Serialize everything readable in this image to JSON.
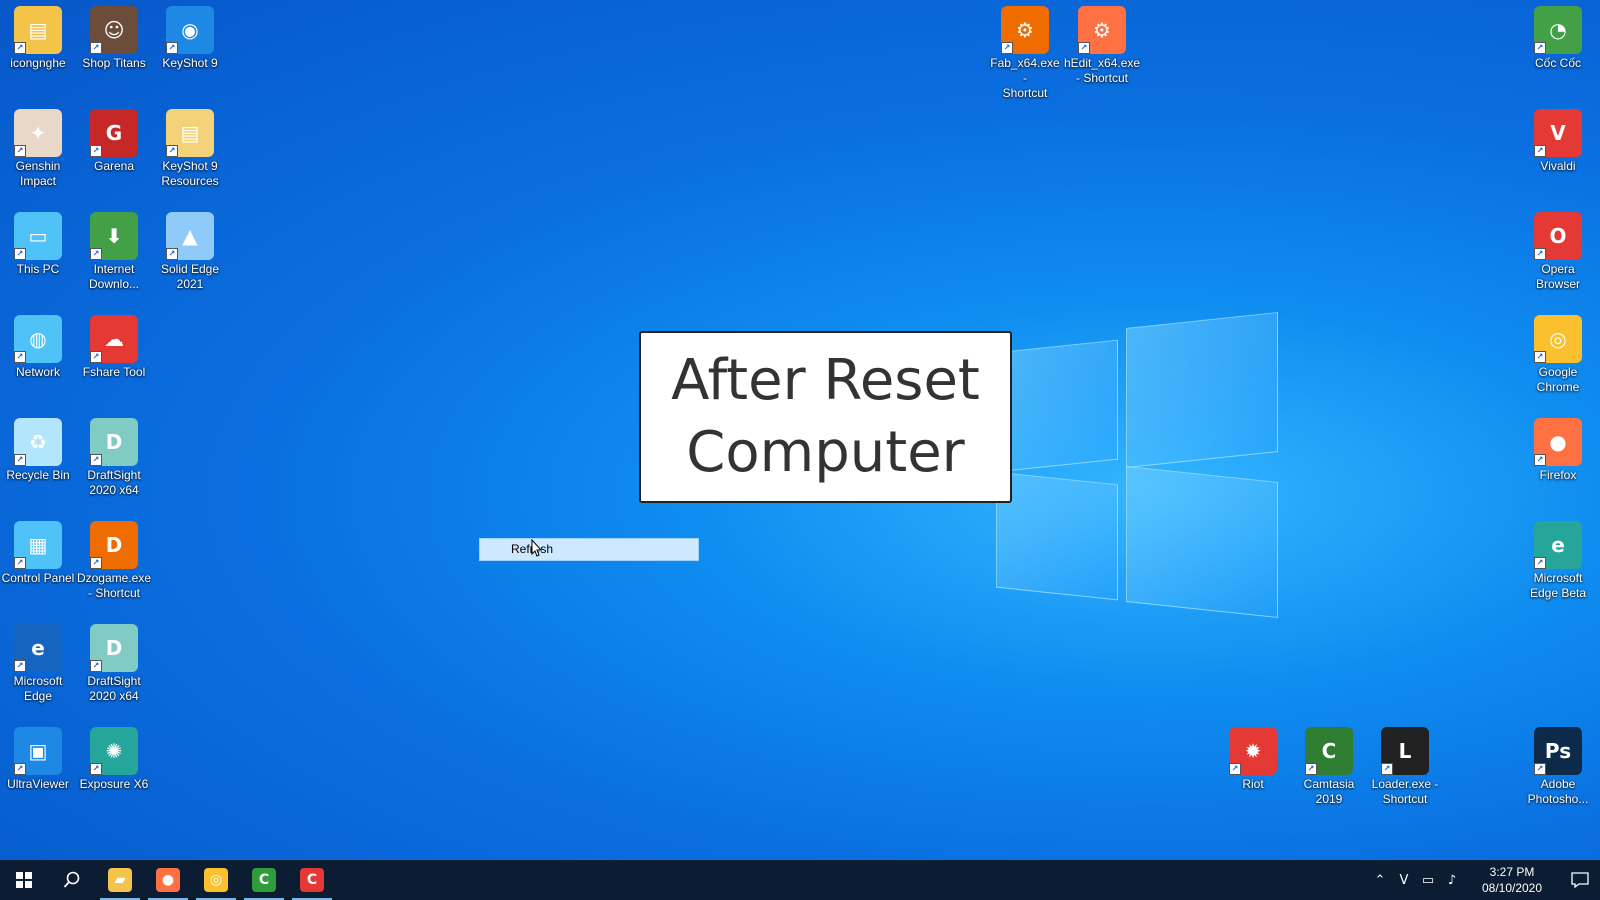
{
  "desktop": {
    "icons_left": [
      {
        "label": "icongnghe",
        "icon": "folder-icon",
        "color": "#f3c34a",
        "glyph": "▤"
      },
      {
        "label": "Shop Titans",
        "icon": "shop-titans-icon",
        "color": "#6b4d3a",
        "glyph": "☺"
      },
      {
        "label": "KeyShot 9",
        "icon": "keyshot-icon",
        "color": "#1e88e5",
        "glyph": "◉"
      },
      {
        "label": "Genshin\nImpact",
        "icon": "genshin-icon",
        "color": "#e9d7c8",
        "glyph": "✦"
      },
      {
        "label": "Garena",
        "icon": "garena-icon",
        "color": "#c62828",
        "glyph": "G"
      },
      {
        "label": "KeyShot 9\nResources",
        "icon": "folder-icon",
        "color": "#f3d27a",
        "glyph": "▤"
      },
      {
        "label": "This PC",
        "icon": "this-pc-icon",
        "color": "#4fc3f7",
        "glyph": "▭"
      },
      {
        "label": "Internet\nDownlo...",
        "icon": "idm-icon",
        "color": "#43a047",
        "glyph": "⬇"
      },
      {
        "label": "Solid Edge\n2021",
        "icon": "solid-edge-icon",
        "color": "#90caf9",
        "glyph": "▲"
      },
      {
        "label": "Network",
        "icon": "network-icon",
        "color": "#4fc3f7",
        "glyph": "◍"
      },
      {
        "label": "Fshare Tool",
        "icon": "fshare-icon",
        "color": "#e53935",
        "glyph": "☁"
      },
      {
        "label": "Recycle Bin",
        "icon": "recycle-bin-icon",
        "color": "#b3e5fc",
        "glyph": "♻"
      },
      {
        "label": "DraftSight\n2020 x64",
        "icon": "draftsight-icon",
        "color": "#80cbc4",
        "glyph": "D"
      },
      {
        "label": "Control Panel",
        "icon": "control-panel-icon",
        "color": "#4fc3f7",
        "glyph": "▦"
      },
      {
        "label": "Dzogame.exe\n- Shortcut",
        "icon": "dzogame-icon",
        "color": "#ef6c00",
        "glyph": "D"
      },
      {
        "label": "Microsoft\nEdge",
        "icon": "edge-icon",
        "color": "#1565c0",
        "glyph": "e"
      },
      {
        "label": "DraftSight\n2020 x64",
        "icon": "draftsight-icon",
        "color": "#80cbc4",
        "glyph": "D"
      },
      {
        "label": "UltraViewer",
        "icon": "ultraviewer-icon",
        "color": "#1e88e5",
        "glyph": "▣"
      },
      {
        "label": "Exposure X6",
        "icon": "exposure-icon",
        "color": "#26a69a",
        "glyph": "✺"
      }
    ],
    "icons_top": [
      {
        "label": "Fab_x64.exe -\nShortcut",
        "icon": "fab-icon",
        "color": "#ef6c00",
        "glyph": "⚙"
      },
      {
        "label": "hEdit_x64.exe\n- Shortcut",
        "icon": "hedit-icon",
        "color": "#ff7043",
        "glyph": "⚙"
      }
    ],
    "icons_right": [
      {
        "label": "Cốc Cốc",
        "icon": "coccoc-icon",
        "color": "#43a047",
        "glyph": "◔"
      },
      {
        "label": "Vivaldi",
        "icon": "vivaldi-icon",
        "color": "#e53935",
        "glyph": "V"
      },
      {
        "label": "Opera\nBrowser",
        "icon": "opera-icon",
        "color": "#e53935",
        "glyph": "O"
      },
      {
        "label": "Google\nChrome",
        "icon": "chrome-icon",
        "color": "#fbc02d",
        "glyph": "◎"
      },
      {
        "label": "Firefox",
        "icon": "firefox-icon",
        "color": "#ff7043",
        "glyph": "●"
      },
      {
        "label": "Microsoft\nEdge Beta",
        "icon": "edge-beta-icon",
        "color": "#26a69a",
        "glyph": "e"
      },
      {
        "label": "Adobe\nPhotosho...",
        "icon": "photoshop-icon",
        "color": "#0d2a4a",
        "glyph": "Ps"
      }
    ],
    "icons_bottom": [
      {
        "label": "Riot",
        "icon": "riot-icon",
        "color": "#e53935",
        "glyph": "✹"
      },
      {
        "label": "Camtasia\n2019",
        "icon": "camtasia-icon",
        "color": "#2e7d32",
        "glyph": "C"
      },
      {
        "label": "Loader.exe -\nShortcut",
        "icon": "loader-icon",
        "color": "#212121",
        "glyph": "L"
      }
    ]
  },
  "banner": {
    "text": "After Reset\nComputer"
  },
  "context_menu": {
    "item_label": "Refresh"
  },
  "taskbar": {
    "pinned": [
      {
        "icon": "file-explorer-icon",
        "glyph": "▰",
        "color": "#f3c34a"
      },
      {
        "icon": "firefox-icon",
        "glyph": "●",
        "color": "#ff7043"
      },
      {
        "icon": "chrome-icon",
        "glyph": "◎",
        "color": "#fbc02d"
      },
      {
        "icon": "camtasia-icon",
        "glyph": "C",
        "color": "#2e9d3a"
      },
      {
        "icon": "camtasia-recorder-icon",
        "glyph": "C",
        "color": "#e53935"
      }
    ],
    "clock": {
      "time": "3:27 PM",
      "date": "08/10/2020"
    }
  }
}
